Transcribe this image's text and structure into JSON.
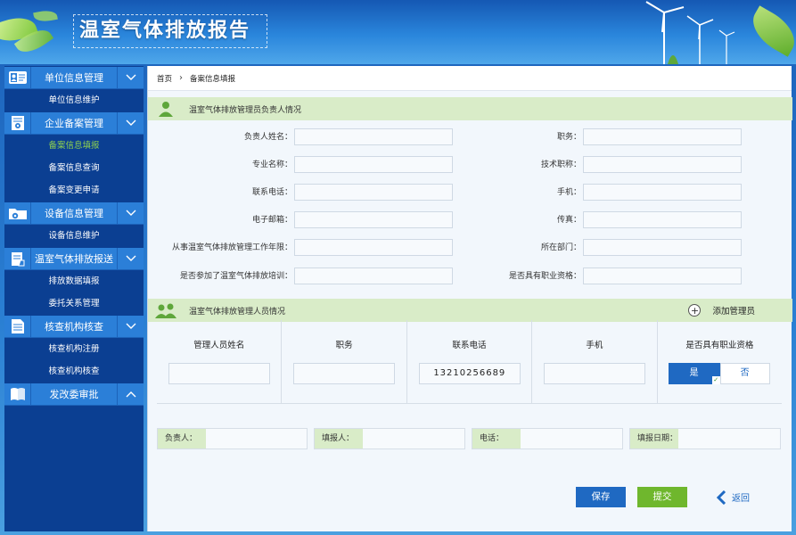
{
  "app": {
    "title": "温室气体排放报告"
  },
  "sidebar": {
    "sections": [
      {
        "icon": "id-card-icon",
        "label": "单位信息管理",
        "chevron": "down",
        "items": [
          {
            "label": "单位信息维护",
            "active": false
          }
        ]
      },
      {
        "icon": "document-gear-icon",
        "label": "企业备案管理",
        "chevron": "down",
        "items": [
          {
            "label": "备案信息填报",
            "active": true
          },
          {
            "label": "备案信息查询",
            "active": false
          },
          {
            "label": "备案变更申请",
            "active": false
          }
        ]
      },
      {
        "icon": "folder-gear-icon",
        "label": "设备信息管理",
        "chevron": "down",
        "items": [
          {
            "label": "设备信息维护",
            "active": false
          }
        ]
      },
      {
        "icon": "report-upload-icon",
        "label": "温室气体排放报送",
        "chevron": "down",
        "items": [
          {
            "label": "排放数据填报",
            "active": false
          },
          {
            "label": "委托关系管理",
            "active": false
          }
        ]
      },
      {
        "icon": "document-list-icon",
        "label": "核查机构核查",
        "chevron": "down",
        "items": [
          {
            "label": "核查机构注册",
            "active": false
          },
          {
            "label": "核查机构核查",
            "active": false
          }
        ]
      },
      {
        "icon": "book-icon",
        "label": "发改委审批",
        "chevron": "up",
        "items": []
      }
    ]
  },
  "breadcrumb": {
    "home": "首页",
    "current": "备案信息填报"
  },
  "responsible": {
    "title": "温室气体排放管理员负责人情况",
    "fields": {
      "name": "负责人姓名：",
      "position": "职务：",
      "major": "专业名称：",
      "tech_title": "技术职称：",
      "phone": "联系电话：",
      "mobile": "手机：",
      "email": "电子邮箱：",
      "fax": "传真：",
      "years": "从事温室气体排放管理工作年限：",
      "dept": "所在部门：",
      "training": "是否参加了温室气体排放培训：",
      "qualified": "是否具有职业资格："
    }
  },
  "staff": {
    "title": "温室气体排放管理人员情况",
    "add_label": "添加管理员",
    "columns": [
      "管理人员姓名",
      "职务",
      "联系电话",
      "手机",
      "是否具有职业资格"
    ],
    "row": {
      "name": "",
      "position": "",
      "phone": "13210256689",
      "mobile": ""
    },
    "toggle": {
      "yes": "是",
      "no": "否",
      "check": "✓"
    }
  },
  "footer": {
    "responsible": "负责人：",
    "filler": "填报人：",
    "phone": "电话：",
    "date": "填报日期："
  },
  "buttons": {
    "save": "保存",
    "submit": "提交",
    "back": "返回"
  }
}
